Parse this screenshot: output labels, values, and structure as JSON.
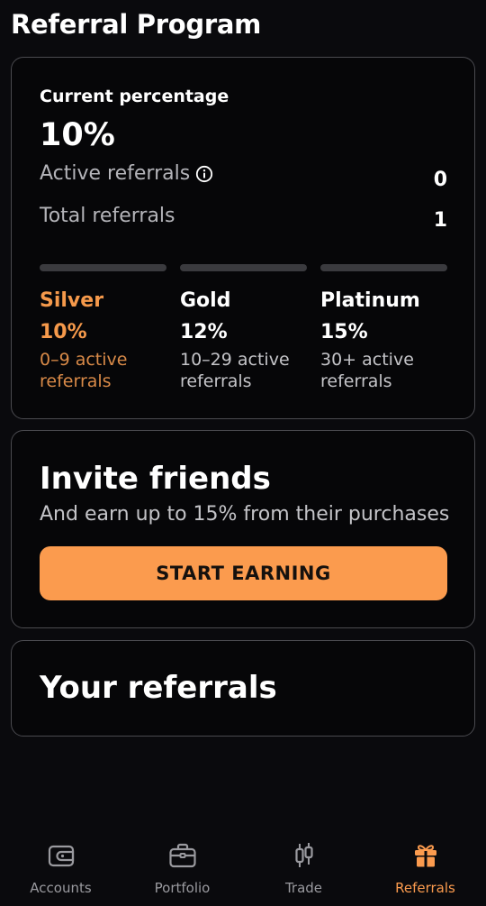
{
  "page": {
    "title": "Referral Program"
  },
  "stats": {
    "current_label": "Current percentage",
    "current_value": "10%",
    "active_label": "Active referrals",
    "active_value": "0",
    "total_label": "Total referrals",
    "total_value": "1"
  },
  "tiers": [
    {
      "name": "Silver",
      "percent": "10%",
      "desc_line1": "0–9 active",
      "desc_line2": "referrals",
      "active": true
    },
    {
      "name": "Gold",
      "percent": "12%",
      "desc_line1": "10–29 active",
      "desc_line2": "referrals",
      "active": false
    },
    {
      "name": "Platinum",
      "percent": "15%",
      "desc_line1": "30+ active",
      "desc_line2": "referrals",
      "active": false
    }
  ],
  "invite": {
    "title": "Invite friends",
    "subtitle": "And earn up to 15% from their purchases",
    "button_label": "START EARNING"
  },
  "referrals": {
    "title": "Your referrals"
  },
  "nav": {
    "items": [
      {
        "label": "Accounts",
        "icon": "wallet-icon"
      },
      {
        "label": "Portfolio",
        "icon": "briefcase-icon"
      },
      {
        "label": "Trade",
        "icon": "candlestick-icon"
      },
      {
        "label": "Referrals",
        "icon": "gift-icon"
      }
    ],
    "active_index": 3
  },
  "colors": {
    "accent": "#fb9b4e",
    "background": "#0a0a0d",
    "card_border": "#4a4a4f",
    "muted_text": "#b4b4b9"
  }
}
